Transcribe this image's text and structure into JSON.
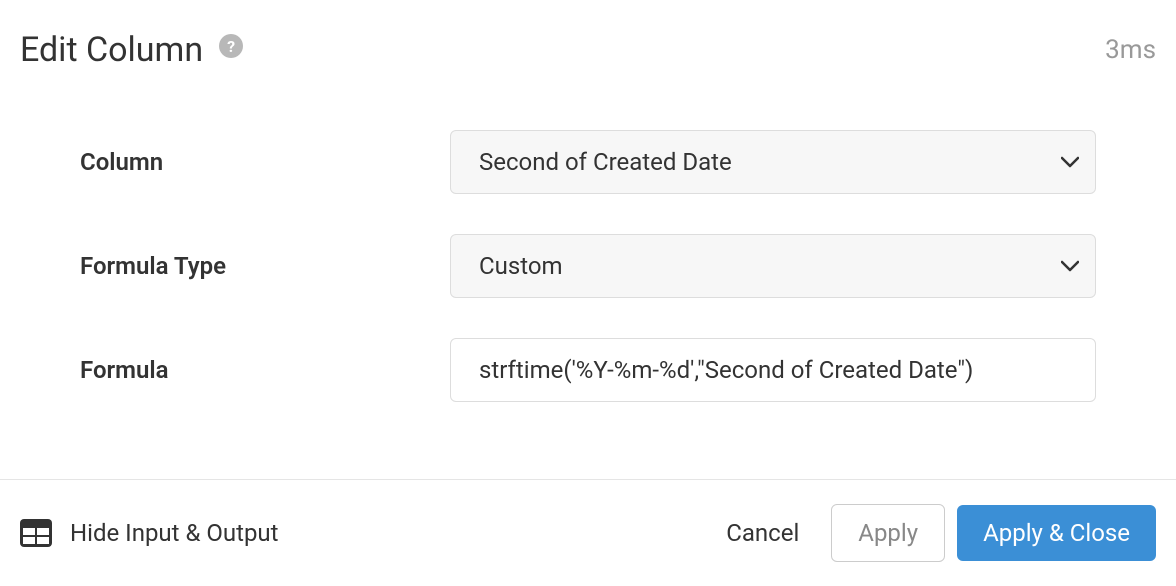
{
  "header": {
    "title": "Edit Column",
    "timing": "3ms"
  },
  "form": {
    "column_label": "Column",
    "column_value": "Second of Created Date",
    "formula_type_label": "Formula Type",
    "formula_type_value": "Custom",
    "formula_label": "Formula",
    "formula_value": "strftime('%Y-%m-%d',\"Second of Created Date\")"
  },
  "footer": {
    "toggle_io_label": "Hide Input & Output",
    "cancel_label": "Cancel",
    "apply_label": "Apply",
    "apply_close_label": "Apply & Close"
  }
}
